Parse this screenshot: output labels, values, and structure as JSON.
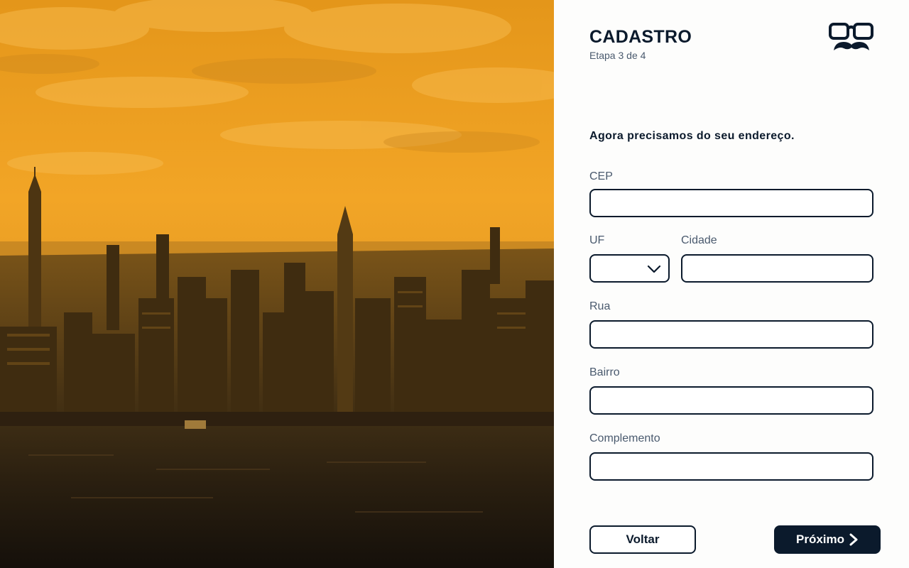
{
  "header": {
    "title": "CADASTRO",
    "step": "Etapa 3 de 4"
  },
  "logo": {
    "icon": "glasses-mustache-icon"
  },
  "hero": {
    "icon": "city-skyline-image"
  },
  "form": {
    "intro": "Agora precisamos do seu endereço.",
    "cep": {
      "label": "CEP",
      "value": ""
    },
    "uf": {
      "label": "UF",
      "value": ""
    },
    "cidade": {
      "label": "Cidade",
      "value": ""
    },
    "rua": {
      "label": "Rua",
      "value": ""
    },
    "bairro": {
      "label": "Bairro",
      "value": ""
    },
    "complemento": {
      "label": "Complemento",
      "value": ""
    }
  },
  "actions": {
    "back_label": "Voltar",
    "next_label": "Próximo"
  },
  "colors": {
    "primary": "#0b1a2c",
    "accent_overlay": "#f0a020",
    "label": "#4a5a6e",
    "background": "#fdfdfc"
  }
}
